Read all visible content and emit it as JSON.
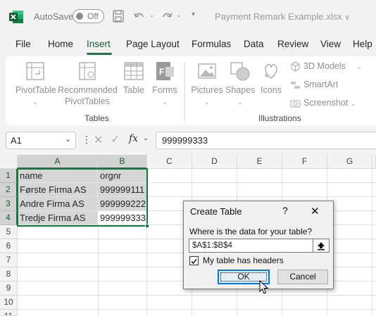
{
  "titlebar": {
    "autosave_label": "AutoSave",
    "autosave_state": "Off",
    "document_title": "Payment Remark Example.xlsx",
    "title_dropdown": "∨"
  },
  "tabs": [
    {
      "label": "File"
    },
    {
      "label": "Home"
    },
    {
      "label": "Insert",
      "active": true
    },
    {
      "label": "Page Layout"
    },
    {
      "label": "Formulas"
    },
    {
      "label": "Data"
    },
    {
      "label": "Review"
    },
    {
      "label": "View"
    },
    {
      "label": "Help"
    }
  ],
  "ribbon": {
    "pivottable": "PivotTable",
    "recommended_line1": "Recommended",
    "recommended_line2": "PivotTables",
    "table": "Table",
    "forms": "Forms",
    "pictures": "Pictures",
    "shapes": "Shapes",
    "icons": "Icons",
    "models_3d": "3D Models",
    "smartart": "SmartArt",
    "screenshot": "Screenshot",
    "group_tables": "Tables",
    "group_illustrations": "Illustrations"
  },
  "formula_bar": {
    "name_box": "A1",
    "fx": "fx",
    "value": "999999333"
  },
  "grid": {
    "columns": [
      "A",
      "B",
      "C",
      "D",
      "E",
      "F",
      "G"
    ],
    "rows": [
      "1",
      "2",
      "3",
      "4",
      "5",
      "6",
      "7",
      "8",
      "9",
      "10",
      "11"
    ],
    "cells": {
      "A1": "name",
      "B1": "orgnr",
      "A2": "Første Firma AS",
      "B2": "999999111",
      "A3": "Andre Firma AS",
      "B3": "999999222",
      "A4": "Tredje Firma AS",
      "B4": "999999333"
    }
  },
  "dialog": {
    "title": "Create Table",
    "help": "?",
    "close": "✕",
    "prompt": "Where is the data for your table?",
    "range": "$A$1:$B$4",
    "headers_label": "My table has headers",
    "headers_checked": true,
    "ok": "OK",
    "cancel": "Cancel"
  },
  "colors": {
    "excel_green": "#217346",
    "selection_fill": "#d6d6d6",
    "ok_border": "#0078d7"
  }
}
